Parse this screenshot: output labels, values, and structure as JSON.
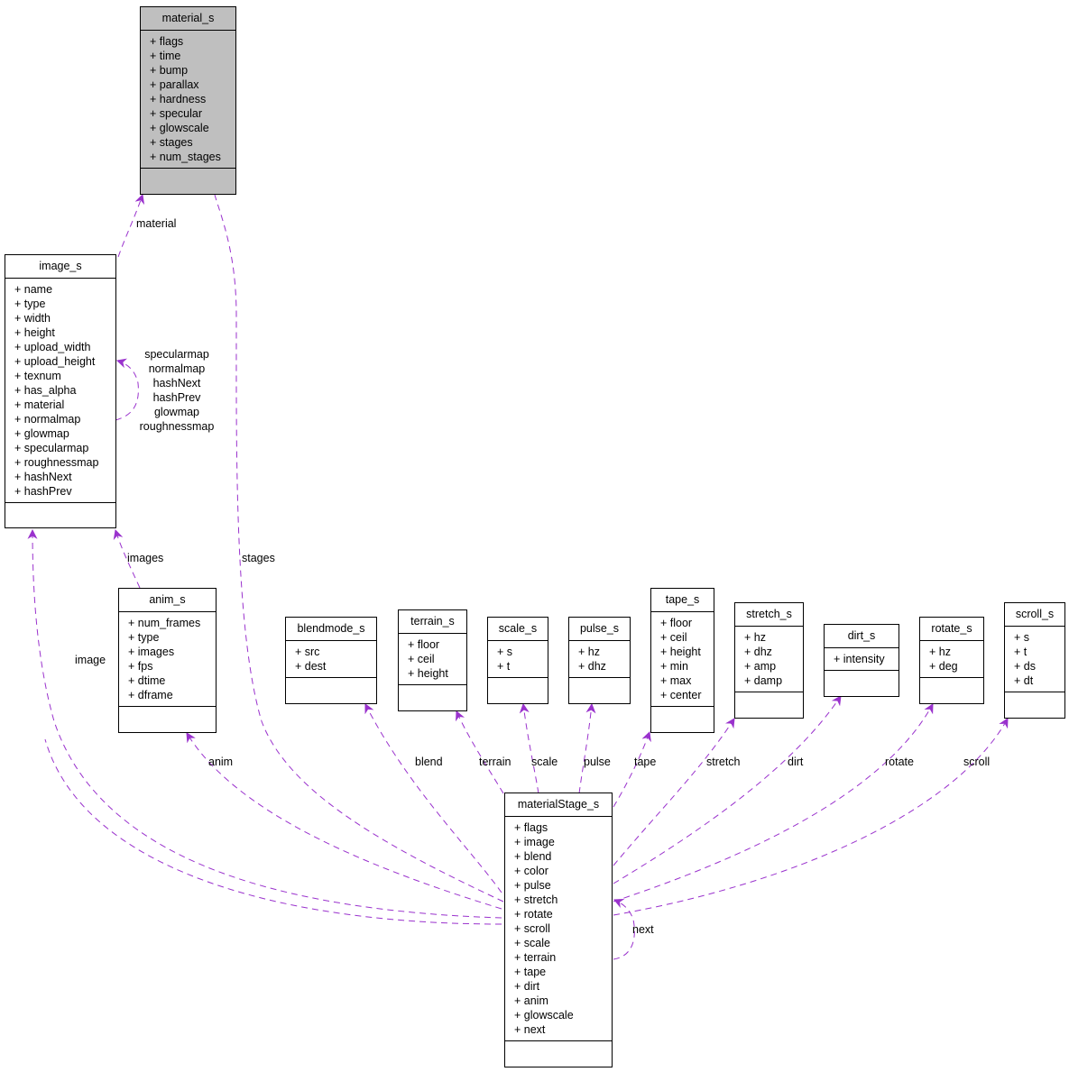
{
  "diagram": {
    "edge_color": "#9a32cd",
    "nodes": {
      "material_s": {
        "name": "material_s",
        "fields": [
          "+ flags",
          "+ time",
          "+ bump",
          "+ parallax",
          "+ hardness",
          "+ specular",
          "+ glowscale",
          "+ stages",
          "+ num_stages"
        ]
      },
      "image_s": {
        "name": "image_s",
        "fields": [
          "+ name",
          "+ type",
          "+ width",
          "+ height",
          "+ upload_width",
          "+ upload_height",
          "+ texnum",
          "+ has_alpha",
          "+ material",
          "+ normalmap",
          "+ glowmap",
          "+ specularmap",
          "+ roughnessmap",
          "+ hashNext",
          "+ hashPrev"
        ]
      },
      "anim_s": {
        "name": "anim_s",
        "fields": [
          "+ num_frames",
          "+ type",
          "+ images",
          "+ fps",
          "+ dtime",
          "+ dframe"
        ]
      },
      "blendmode_s": {
        "name": "blendmode_s",
        "fields": [
          "+ src",
          "+ dest"
        ]
      },
      "terrain_s": {
        "name": "terrain_s",
        "fields": [
          "+ floor",
          "+ ceil",
          "+ height"
        ]
      },
      "scale_s": {
        "name": "scale_s",
        "fields": [
          "+ s",
          "+ t"
        ]
      },
      "pulse_s": {
        "name": "pulse_s",
        "fields": [
          "+ hz",
          "+ dhz"
        ]
      },
      "tape_s": {
        "name": "tape_s",
        "fields": [
          "+ floor",
          "+ ceil",
          "+ height",
          "+ min",
          "+ max",
          "+ center"
        ]
      },
      "stretch_s": {
        "name": "stretch_s",
        "fields": [
          "+ hz",
          "+ dhz",
          "+ amp",
          "+ damp"
        ]
      },
      "dirt_s": {
        "name": "dirt_s",
        "fields": [
          "+ intensity"
        ]
      },
      "rotate_s": {
        "name": "rotate_s",
        "fields": [
          "+ hz",
          "+ deg"
        ]
      },
      "scroll_s": {
        "name": "scroll_s",
        "fields": [
          "+ s",
          "+ t",
          "+ ds",
          "+ dt"
        ]
      },
      "materialStage_s": {
        "name": "materialStage_s",
        "fields": [
          "+ flags",
          "+ image",
          "+ blend",
          "+ color",
          "+ pulse",
          "+ stretch",
          "+ rotate",
          "+ scroll",
          "+ scale",
          "+ terrain",
          "+ tape",
          "+ dirt",
          "+ anim",
          "+ glowscale",
          "+ next"
        ]
      }
    },
    "edge_labels": {
      "material": "material",
      "stages": "stages",
      "image_self": [
        "specularmap",
        "normalmap",
        "hashNext",
        "hashPrev",
        "glowmap",
        "roughnessmap"
      ],
      "images": "images",
      "image": "image",
      "anim": "anim",
      "blend": "blend",
      "terrain": "terrain",
      "scale": "scale",
      "pulse": "pulse",
      "tape": "tape",
      "stretch": "stretch",
      "dirt": "dirt",
      "rotate": "rotate",
      "scroll": "scroll",
      "next": "next"
    }
  }
}
